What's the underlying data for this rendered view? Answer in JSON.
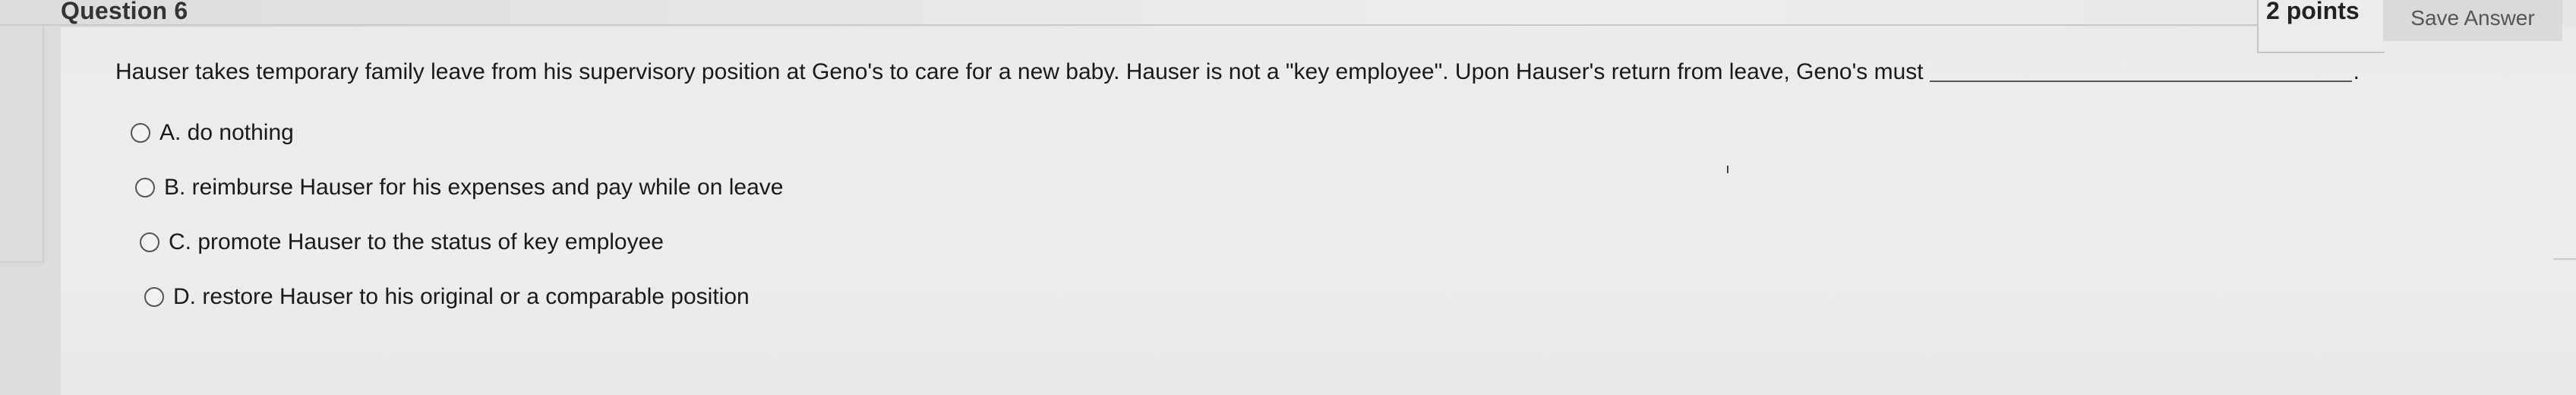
{
  "question": {
    "title": "Question 6",
    "points": "2 points",
    "save_label": "Save Answer",
    "text": "Hauser takes temporary family leave from his supervisory position at Geno's to care for a new baby.  Hauser is not a \"key employee\".  Upon Hauser's return from leave, Geno's must",
    "trailing_punct": "."
  },
  "options": [
    {
      "label": "A. do nothing"
    },
    {
      "label": "B. reimburse Hauser for his expenses and pay while on leave"
    },
    {
      "label": "C. promote Hauser to the status of key employee"
    },
    {
      "label": "D. restore Hauser to his original or a comparable position"
    }
  ],
  "colors": {
    "background": "#e4e4e4",
    "text": "#1a1a1a",
    "button_bg": "#dadada"
  }
}
